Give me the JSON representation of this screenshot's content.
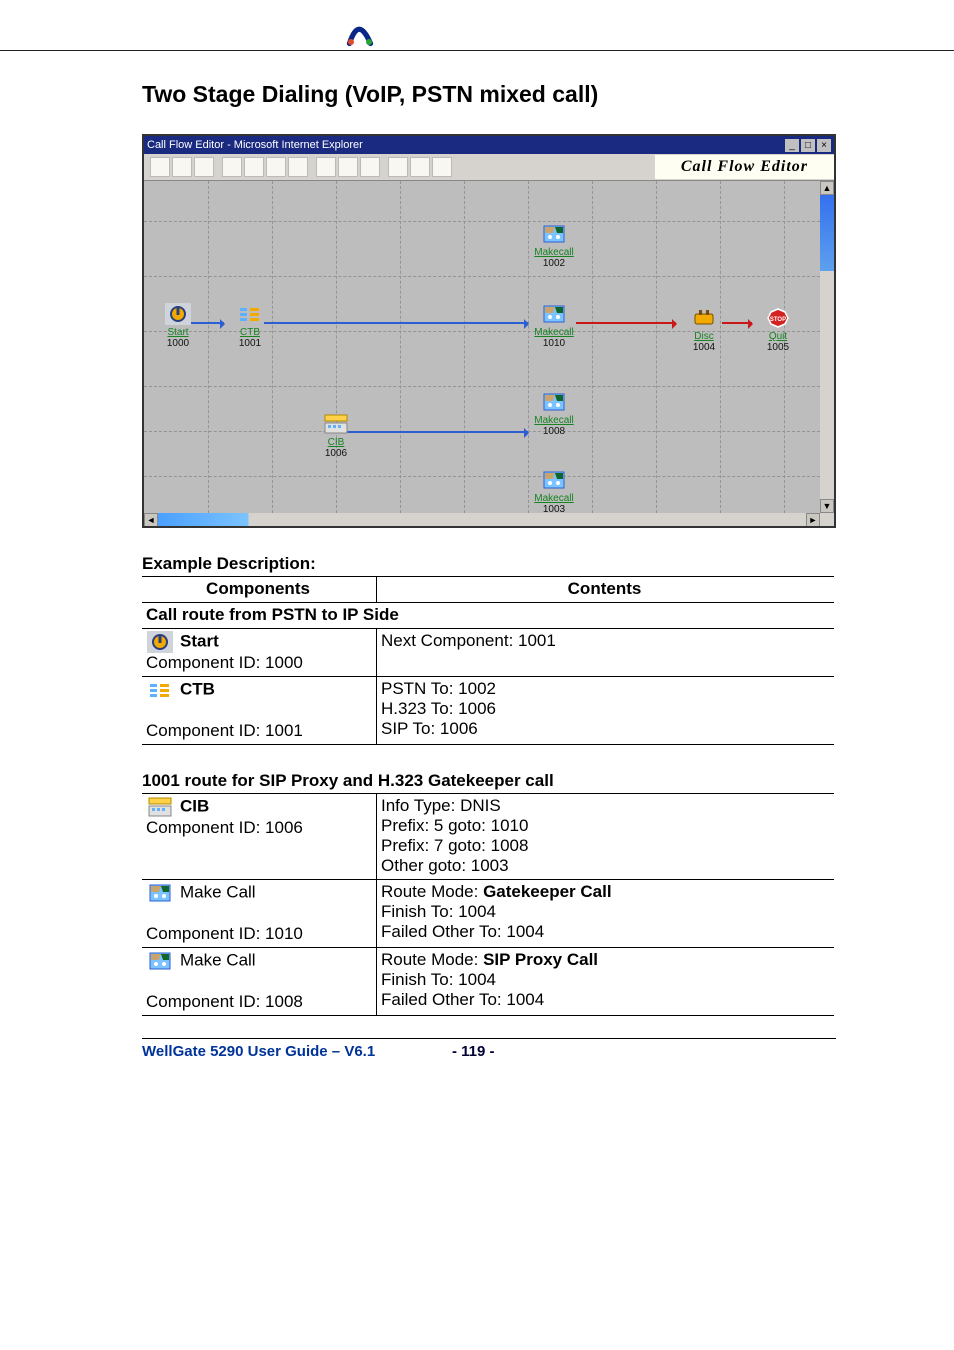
{
  "header": {
    "logo_text": ""
  },
  "title": "Two Stage Dialing (VoIP, PSTN mixed call)",
  "window": {
    "titlebar": "Call Flow Editor - Microsoft Internet Explorer",
    "brand": "Call Flow Editor",
    "win_min": "_",
    "win_max": "□",
    "win_close": "×",
    "scroll_left": "◄",
    "scroll_right": "►",
    "scroll_up": "▲",
    "scroll_down": "▼"
  },
  "nodes": {
    "start": {
      "label": "Start",
      "id": "1000"
    },
    "ctb": {
      "label": "CTB",
      "id": "1001"
    },
    "cib": {
      "label": "CIB",
      "id": "1006"
    },
    "mc1002": {
      "label": "Makecall",
      "id": "1002"
    },
    "mc1010": {
      "label": "Makecall",
      "id": "1010"
    },
    "mc1008": {
      "label": "Makecall",
      "id": "1008"
    },
    "mc1003": {
      "label": "Makecall",
      "id": "1003"
    },
    "disc": {
      "label": "Disc",
      "id": "1004"
    },
    "quit": {
      "label": "Quit",
      "id": "1005"
    }
  },
  "example_heading": "Example Description:",
  "table1": {
    "h1": "Components",
    "h2": "Contents",
    "flow_row": "Call route from PSTN to IP Side",
    "start": {
      "name": "Start",
      "sub": "Component ID: 1000",
      "contents": "Next Component: 1001"
    },
    "ctb": {
      "name": "CTB",
      "sub": "Component ID: 1001",
      "c_l1": "PSTN To: 1002",
      "c_l2": "H.323 To: 1006",
      "c_l3": "SIP To: 1006"
    }
  },
  "subtitle2": "1001 route for SIP Proxy and H.323 Gatekeeper call",
  "table2": {
    "cib": {
      "name": "CIB",
      "sub": "Component ID: 1006",
      "c_l1": "Info Type: DNIS",
      "c_l2": "Prefix: 5 goto: 1010",
      "c_l3": "Prefix: 7 goto: 1008",
      "c_l4": "Other goto: 1003"
    },
    "mc1010": {
      "name": "Make Call",
      "sub": "Component ID: 1010",
      "c_l1_pre": "Route Mode: ",
      "c_l1_b": "Gatekeeper Call",
      "c_l2": "Finish To: 1004",
      "c_l3": "Failed Other To: 1004"
    },
    "mc1008": {
      "name": "Make Call",
      "sub": "Component ID: 1008",
      "c_l1_pre": "Route Mode: ",
      "c_l1_b": "SIP Proxy Call",
      "c_l2": "Finish To: 1004",
      "c_l3": "Failed Other To: 1004"
    }
  },
  "footer": {
    "left": "WellGate 5290 User Guide – V6.1",
    "page": "- 119 -"
  },
  "icons": {
    "start_fill": "#f2a900",
    "ctb_fill": "#59b0ff",
    "cib_fill": "#ffd24a",
    "make_fill": "#4aa0ff",
    "make_head": "#c9a46c",
    "disc_fill": "#f2a900",
    "quit_fill": "#d32222",
    "quit_text": "STOP"
  }
}
